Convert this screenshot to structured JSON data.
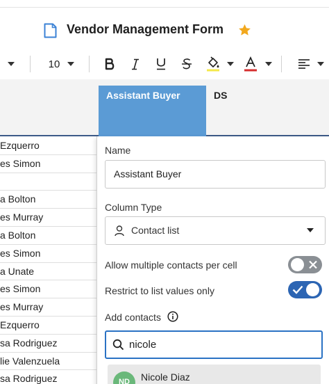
{
  "document": {
    "title": "Vendor Management Form"
  },
  "toolbar": {
    "font_size": "10"
  },
  "columns": {
    "active_header": "Assistant Buyer",
    "next_header": "DS"
  },
  "grid": {
    "rows": [
      " Ezquerro",
      "es Simon",
      "",
      "a Bolton",
      "es Murray",
      "a Bolton",
      "es Simon",
      "a Unate",
      "es Simon",
      "es Murray",
      " Ezquerro",
      "sa Rodriguez",
      "lie Valenzuela",
      "sa Rodriguez"
    ]
  },
  "panel": {
    "name_label": "Name",
    "name_value": "Assistant Buyer",
    "column_type_label": "Column Type",
    "column_type_value": "Contact list",
    "allow_multiple_label": "Allow multiple contacts per cell",
    "allow_multiple_on": false,
    "restrict_label": "Restrict to list values only",
    "restrict_on": true,
    "add_contacts_label": "Add contacts",
    "search_value": "nicole",
    "suggestion": {
      "initials": "ND",
      "name": "Nicole Diaz"
    }
  },
  "colors": {
    "accent": "#2c65b3",
    "column_highlight": "#5b9bd5",
    "star": "#f2a81d",
    "avatar": "#6ab87a"
  }
}
